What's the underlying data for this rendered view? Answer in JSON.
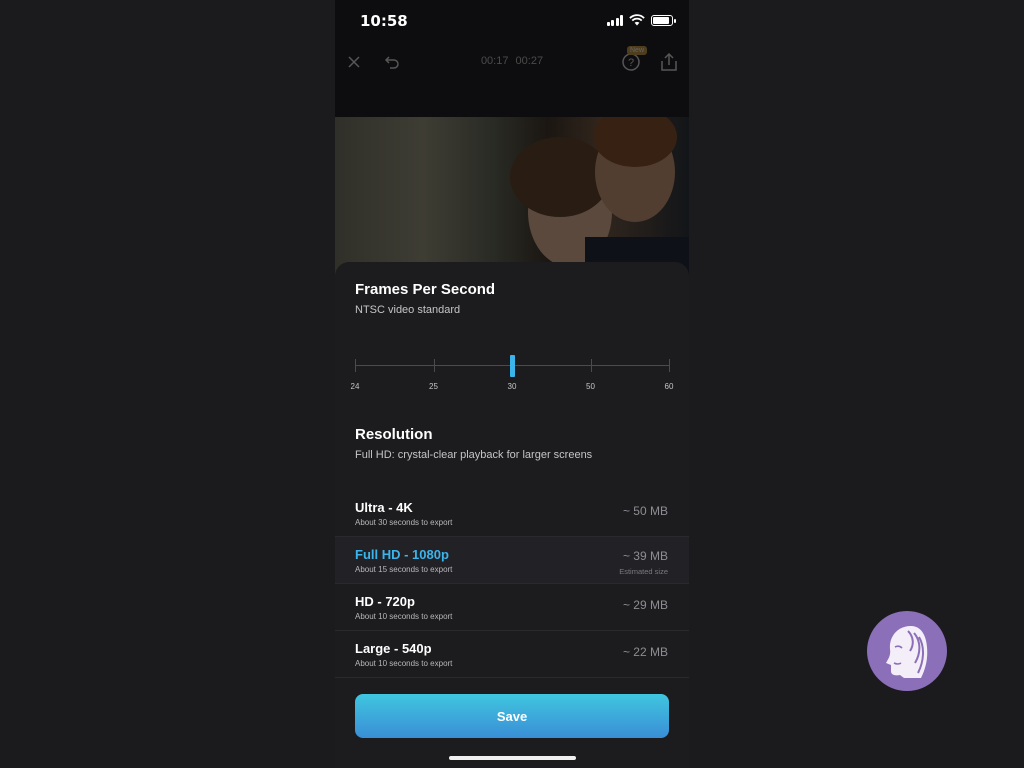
{
  "status_bar": {
    "time": "10:58",
    "battery_level": 0.9
  },
  "toolbar": {
    "current_time": "00:17",
    "total_time": "00:27",
    "new_badge": "New"
  },
  "fps": {
    "title": "Frames Per Second",
    "subtitle": "NTSC video standard",
    "options": [
      "24",
      "25",
      "30",
      "50",
      "60"
    ],
    "selected": "30",
    "accent": "#3bb4ec"
  },
  "resolution": {
    "title": "Resolution",
    "subtitle": "Full HD: crystal-clear playback for larger screens",
    "items": [
      {
        "name": "Ultra - 4K",
        "time": "About 30 seconds to export",
        "size": "~ 50 MB",
        "note": ""
      },
      {
        "name": "Full HD - 1080p",
        "time": "About 15 seconds to export",
        "size": "~ 39 MB",
        "note": "Estimated size"
      },
      {
        "name": "HD - 720p",
        "time": "About 10 seconds to export",
        "size": "~ 29 MB",
        "note": ""
      },
      {
        "name": "Large - 540p",
        "time": "About 10 seconds to export",
        "size": "~ 22 MB",
        "note": ""
      }
    ],
    "selected_index": 1
  },
  "save_label": "Save"
}
